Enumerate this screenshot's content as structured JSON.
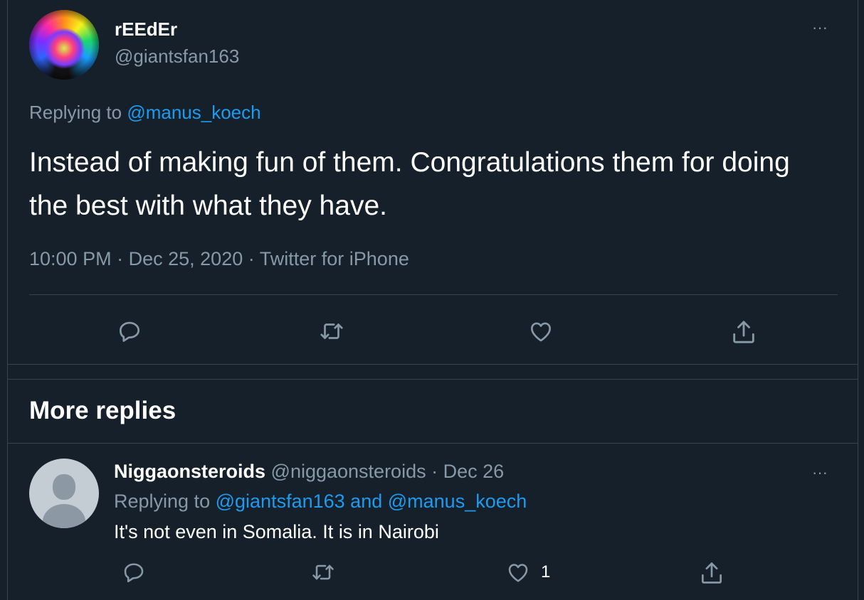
{
  "main_tweet": {
    "display_name": "rEEdEr",
    "handle": "@giantsfan163",
    "replying_prefix": "Replying to",
    "replying_to": "@manus_koech",
    "text": "Instead of making fun of them. Congratulations them for doing the best with what they have.",
    "time": "10:00 PM",
    "date": "Dec 25, 2020",
    "source": "Twitter for iPhone",
    "separator": "·",
    "more_icon": "···",
    "actions": {
      "reply_icon": "reply-icon",
      "retweet_icon": "retweet-icon",
      "like_icon": "heart-icon",
      "share_icon": "share-icon"
    }
  },
  "section": {
    "title": "More replies"
  },
  "reply": {
    "display_name": "Niggaonsteroids",
    "handle": "@niggaonsteroids",
    "separator": "·",
    "date": "Dec 26",
    "more_icon": "···",
    "replying_prefix": "Replying to",
    "replying_to_1": "@giantsfan163",
    "replying_and": "and",
    "replying_to_2": "@manus_koech",
    "text": "It's not even in Somalia. It is in Nairobi",
    "like_count": "1"
  },
  "colors": {
    "background": "#15202b",
    "text": "#ffffff",
    "muted": "#8899a6",
    "link": "#1d9bf0",
    "border": "#38444d"
  }
}
